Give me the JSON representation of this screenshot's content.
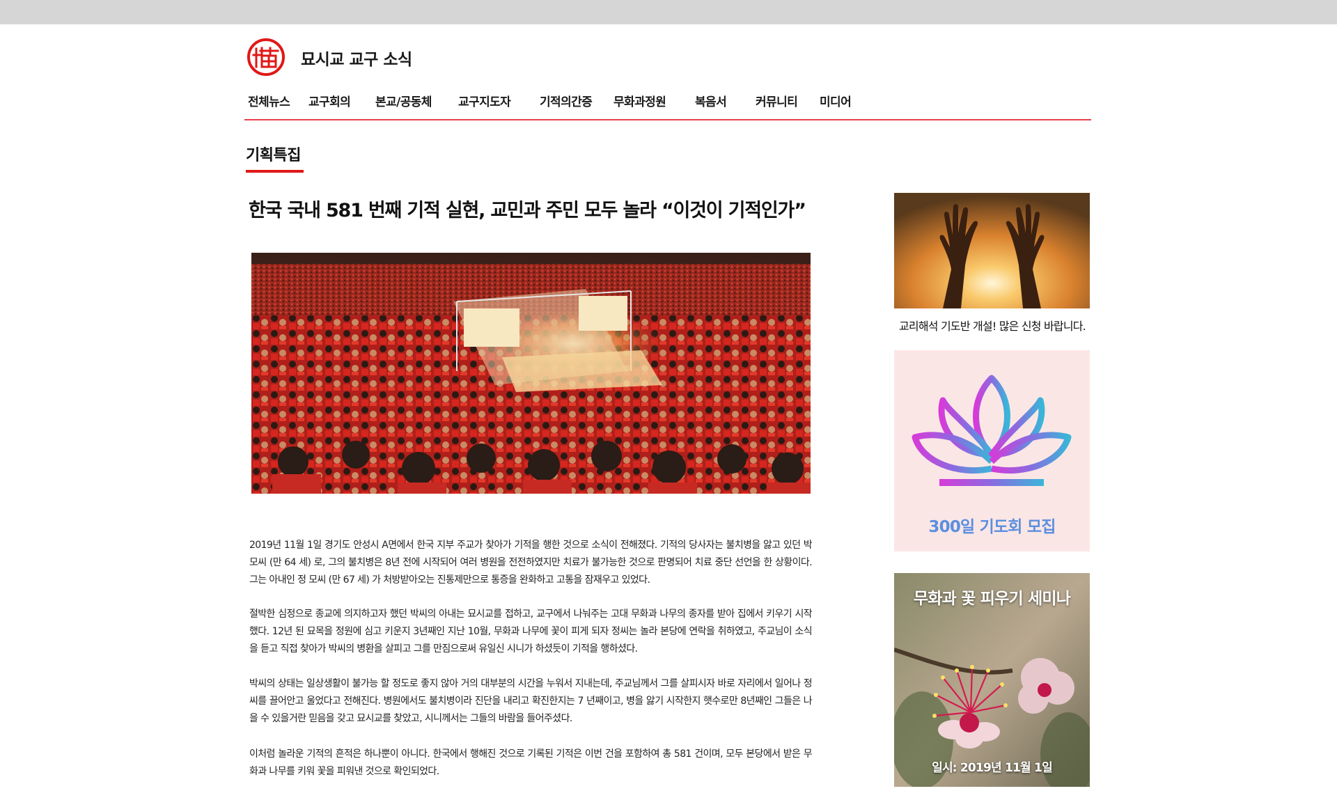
{
  "header": {
    "site_title": "묘시교 교구 소식",
    "logo_icon": "cat-seal-logo",
    "accent_color": "#e01818"
  },
  "nav": {
    "items": [
      "전체뉴스",
      "교구회의",
      "본교/공동체",
      "교구지도자",
      "기적의간증",
      "무화과정원",
      "복음서",
      "커뮤니티",
      "미디어"
    ]
  },
  "section": {
    "title": "기획특집"
  },
  "article": {
    "headline": "한국 국내 581 번째 기적 실현, 교민과 주민 모두 놀라 “이것이 기적인가”",
    "paragraphs": [
      "2019년 11월 1일 경기도 안성시 A면에서 한국 지부 주교가 찾아가 기적을 행한 것으로 소식이 전해졌다. 기적의 당사자는 불치병을 앓고 있던 박 모씨 (만 64 세) 로, 그의 불치병은 8년 전에 시작되어 여러 병원을 전전하였지만 치료가 불가능한 것으로 판명되어 치료 중단 선언을 한 상황이다. 그는 아내인 정 모씨 (만 67 세) 가 처방받아오는 진통제만으로 통증을 완화하고 고통을 잠재우고 있었다.",
      "절박한 심정으로 종교에 의지하고자 했던 박씨의 아내는 묘시교를 접하고, 교구에서 나눠주는 고대 무화과 나무의 종자를 받아 집에서 키우기 시작했다. 12년 된 묘목을 정원에 심고 키운지 3년째인 지난 10월, 무화과 나무에 꽃이 피게 되자 정씨는 놀라 본당에 연락을 취하였고, 주교님이 소식을 듣고 직접 찾아가 박씨의 병환을 살피고 그를 만짐으로써 유일신 시니가 하셨듯이 기적을 행하셨다.",
      "박씨의 상태는 일상생활이 불가능 할 정도로 좋지 않아 거의 대부분의 시간을 누워서 지내는데, 주교님께서 그를 살피시자 바로 자리에서 일어나 정씨를 끌어안고 울었다고 전해진다. 병원에서도 불치병이라 진단을 내리고 확진한지는 7 년째이고, 병을 앓기 시작한지 햇수로만 8년째인 그들은 나을 수 있을거란 믿음을 갖고 묘시교를 찾았고, 시니께서는 그들의 바람을 들어주셨다.",
      "이처럼 놀라운 기적의 흔적은 하나뿐이 아니다. 한국에서 행해진 것으로 기록된 기적은 이번 건을 포함하여 총 581 건이며, 모두 본당에서 받은 무화과 나무를 키워 꽃을 피워낸 것으로 확인되었다."
    ]
  },
  "sidebar": {
    "banner1_caption": "교리해석 기도반 개설! 많은 신청 바랍니다.",
    "banner2_label": "300일 기도회 모집",
    "banner2_icon": "lotus-icon",
    "banner3_title": "무화과 꽃 피우기 세미나",
    "banner3_date": "일시: 2019년 11월 1일"
  }
}
